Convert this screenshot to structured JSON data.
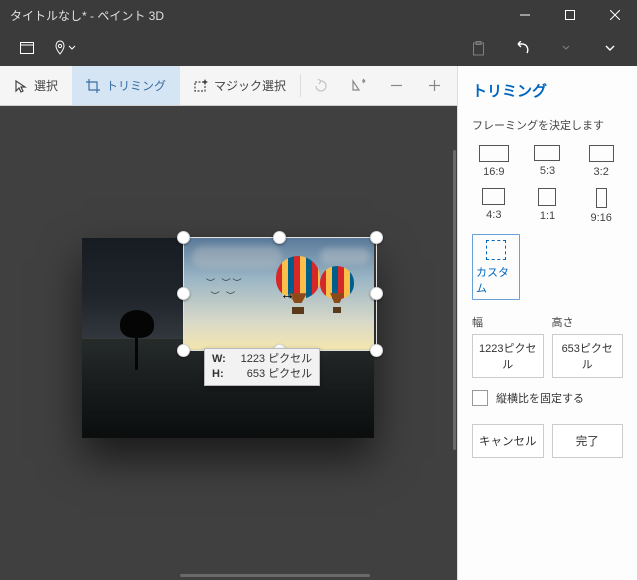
{
  "window": {
    "title": "タイトルなし* - ペイント 3D"
  },
  "tools": {
    "select": "選択",
    "crop": "トリミング",
    "magic": "マジック選択"
  },
  "tooltip": {
    "w_label": "W:",
    "w_value": "1223",
    "w_unit": "ピクセル",
    "h_label": "H:",
    "h_value": "653",
    "h_unit": "ピクセル"
  },
  "panel": {
    "title": "トリミング",
    "framing_label": "フレーミングを決定します",
    "ratios": {
      "r169": "16:9",
      "r53": "5:3",
      "r32": "3:2",
      "r43": "4:3",
      "r11": "1:1",
      "r916": "9:16",
      "custom": "カスタム"
    },
    "width_label": "幅",
    "height_label": "高さ",
    "width_value": "1223ピクセル",
    "height_value": "653ピクセル",
    "lock_ratio": "縦横比を固定する",
    "cancel": "キャンセル",
    "done": "完了"
  }
}
